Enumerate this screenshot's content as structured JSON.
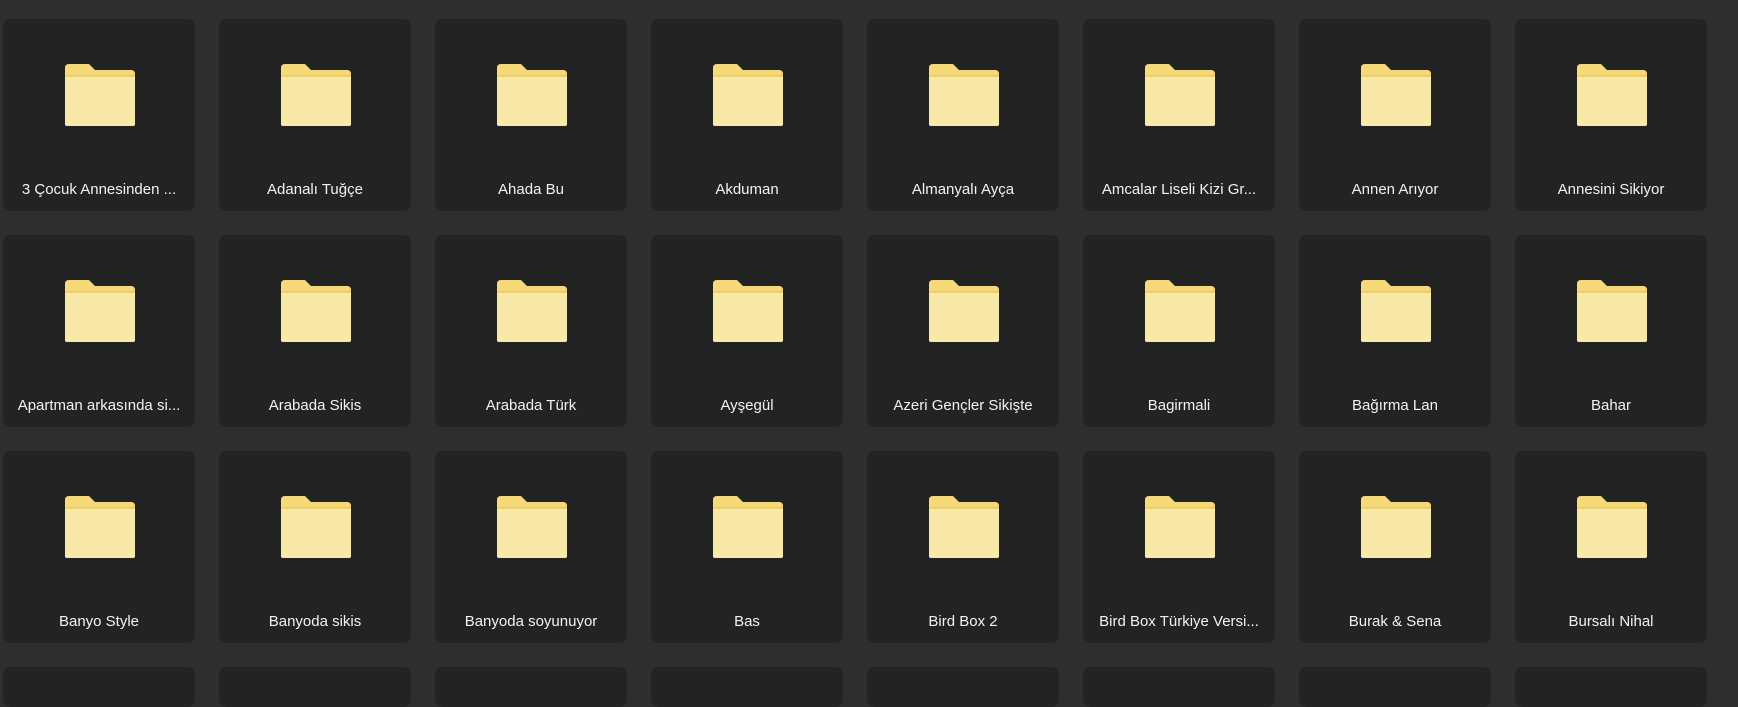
{
  "folders": [
    {
      "name": "3 Çocuk Annesinden ..."
    },
    {
      "name": "Adanalı Tuğçe"
    },
    {
      "name": "Ahada Bu"
    },
    {
      "name": "Akduman"
    },
    {
      "name": "Almanyalı Ayça"
    },
    {
      "name": "Amcalar Liseli Kizi Gr..."
    },
    {
      "name": "Annen Arıyor"
    },
    {
      "name": "Annesini Sikiyor"
    },
    {
      "name": "Apartman arkasında si..."
    },
    {
      "name": "Arabada Sikis"
    },
    {
      "name": "Arabada Türk"
    },
    {
      "name": "Ayşegül"
    },
    {
      "name": "Azeri Gençler Sikişte"
    },
    {
      "name": "Bagirmali"
    },
    {
      "name": "Bağırma Lan"
    },
    {
      "name": "Bahar"
    },
    {
      "name": "Banyo Style"
    },
    {
      "name": "Banyoda sikis"
    },
    {
      "name": "Banyoda soyunuyor"
    },
    {
      "name": "Bas"
    },
    {
      "name": "Bird Box 2"
    },
    {
      "name": "Bird Box Türkiye Versi..."
    },
    {
      "name": "Burak & Sena"
    },
    {
      "name": "Bursalı Nihal"
    }
  ],
  "folder_icon": "folder-icon",
  "colors": {
    "background": "#2e2e2e",
    "tile": "#232323",
    "folder_front": "#f9e9a9",
    "folder_back": "#f5d877",
    "label": "#f2f2f2"
  }
}
